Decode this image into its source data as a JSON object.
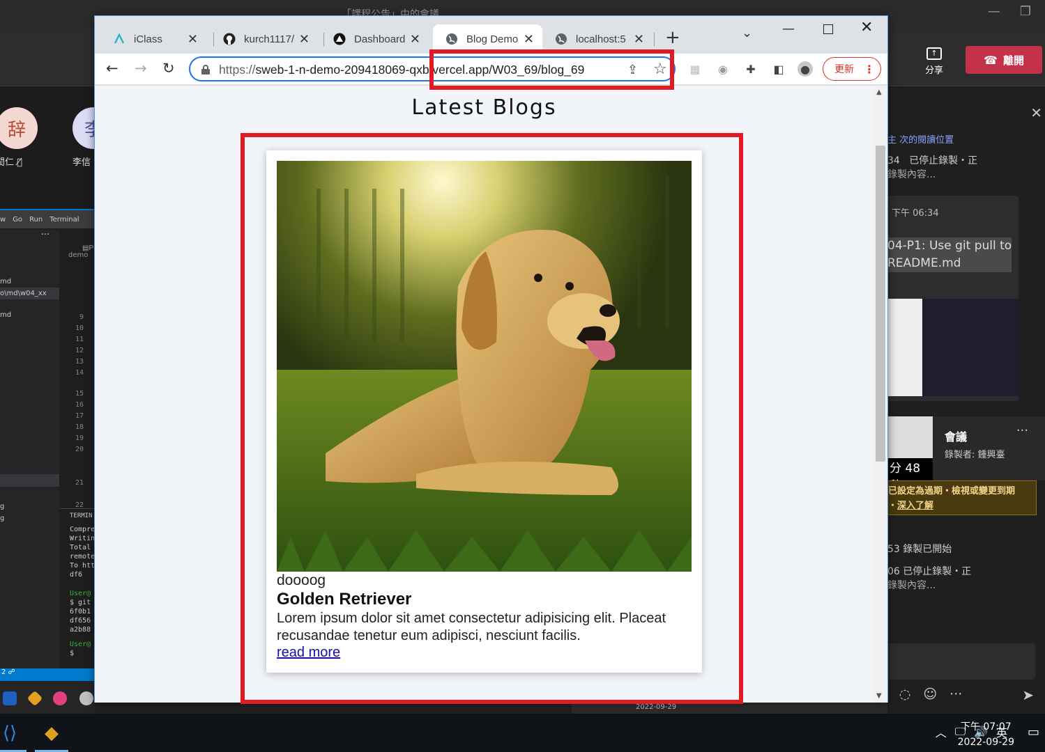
{
  "meeting": {
    "title_fragment": "「課程公告」中的會議",
    "share_label": "分享",
    "leave_label": "離開",
    "participants": [
      {
        "initial": "辞",
        "name_fragment": "閎仁"
      },
      {
        "initial": "李",
        "name_fragment": "李信"
      }
    ],
    "chat": [
      {
        "time_fragment": "34",
        "text": "已停止錄製・正"
      },
      {
        "time_fragment": "",
        "text": "錄製內容..."
      }
    ],
    "message_card": {
      "time": "下午 06:34",
      "line1": "04-P1: Use git pull to",
      "line2": "README.md"
    },
    "recording_card": {
      "duration_fragment": "分 48秒",
      "title": "會議",
      "recorded_by": "錄製者: 鍾興臺",
      "more": "···"
    },
    "expire_note": {
      "line1": "已設定為過期・檢視或變更到期",
      "line2_prefix": "・",
      "link": "深入了解"
    },
    "chat_after": [
      {
        "text": "53   錄製已開始"
      },
      {
        "text": "06   已停止錄製・正"
      },
      {
        "text": "錄製內容..."
      }
    ]
  },
  "vscode": {
    "menu": [
      "w",
      "Go",
      "Run",
      "Terminal"
    ],
    "files": [
      "md",
      "o\\md\\w04_xx",
      "md"
    ],
    "editor_tab": "Previ",
    "breadcrumb": "demo",
    "line_numbers": [
      "9",
      "10",
      "11",
      "12",
      "13",
      "14",
      "15",
      "16",
      "17",
      "18",
      "19",
      "20",
      "21",
      "22"
    ],
    "terminal_header": "TERMIN",
    "terminal_lines": [
      "Compre",
      "Writin",
      "Total",
      "remote",
      "To htt",
      "   df6"
    ],
    "terminal_lines2": [
      "User@",
      "$ git",
      "6f0b1",
      "df656",
      "a2b88"
    ],
    "terminal_lines3": [
      "User@",
      "$ "
    ],
    "status": "2  ☍"
  },
  "taskbar": {
    "clock_time": "下午 07:07",
    "clock_date": "2022-09-29",
    "lang": "英",
    "mini_date": "2022-09-29"
  },
  "browser": {
    "tabs": [
      {
        "label": "iClass",
        "icon": "iclass-icon"
      },
      {
        "label": "kurch1117/",
        "icon": "github-icon"
      },
      {
        "label": "Dashboard",
        "icon": "vercel-icon"
      },
      {
        "label": "Blog Demo",
        "icon": "globe-icon",
        "active": true
      },
      {
        "label": "localhost:5",
        "icon": "globe-icon"
      }
    ],
    "address": {
      "scheme": "https://",
      "host": "sweb-1-n-demo-209418069-qxb.vercel.app",
      "path": "/W03_69/blog_69"
    },
    "update_label": "更新"
  },
  "page": {
    "heading": "Latest Blogs",
    "blog": {
      "category": "doooog",
      "title": "Golden Retriever",
      "excerpt": "Lorem ipsum dolor sit amet consectetur adipisicing elit. Placeat recusandae tenetur eum adipisci, nesciunt facilis.",
      "link": "read more"
    }
  },
  "colors": {
    "highlight": "#e01b24",
    "link": "#1a0dab",
    "leave": "#c4314b",
    "accent": "#1a73e8"
  }
}
